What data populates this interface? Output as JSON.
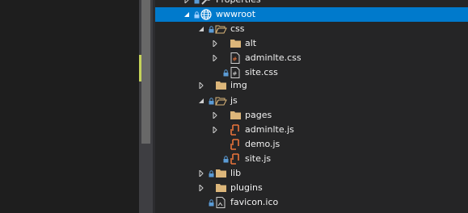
{
  "colors": {
    "selection": "#007acc",
    "folder": "#dcb67a",
    "lock": "#5b9bd5",
    "file_orange": "#e8733a",
    "scroll_mark": "#c6d45a"
  },
  "tree": {
    "items": [
      {
        "label": "Properties",
        "expander": "right",
        "locked": true,
        "icon": "wrench-icon"
      },
      {
        "label": "wwwroot",
        "expander": "down",
        "locked": true,
        "icon": "globe-icon",
        "selected": true
      },
      {
        "label": "css",
        "expander": "down",
        "locked": true,
        "icon": "folder-open-icon"
      },
      {
        "label": "alt",
        "expander": "right",
        "locked": false,
        "icon": "folder-icon"
      },
      {
        "label": "adminlte.css",
        "expander": "right",
        "locked": false,
        "icon": "css-file-icon"
      },
      {
        "label": "site.css",
        "expander": "none",
        "locked": true,
        "icon": "css-file-icon"
      },
      {
        "label": "img",
        "expander": "right",
        "locked": false,
        "icon": "folder-icon"
      },
      {
        "label": "js",
        "expander": "down",
        "locked": true,
        "icon": "folder-open-icon"
      },
      {
        "label": "pages",
        "expander": "right",
        "locked": false,
        "icon": "folder-icon"
      },
      {
        "label": "adminlte.js",
        "expander": "right",
        "locked": false,
        "icon": "js-file-icon"
      },
      {
        "label": "demo.js",
        "expander": "none",
        "locked": false,
        "icon": "js-file-icon"
      },
      {
        "label": "site.js",
        "expander": "none",
        "locked": true,
        "icon": "js-file-icon"
      },
      {
        "label": "lib",
        "expander": "right",
        "locked": true,
        "icon": "folder-icon"
      },
      {
        "label": "plugins",
        "expander": "right",
        "locked": false,
        "icon": "folder-icon"
      },
      {
        "label": "favicon.ico",
        "expander": "none",
        "locked": true,
        "icon": "image-file-icon"
      }
    ]
  }
}
